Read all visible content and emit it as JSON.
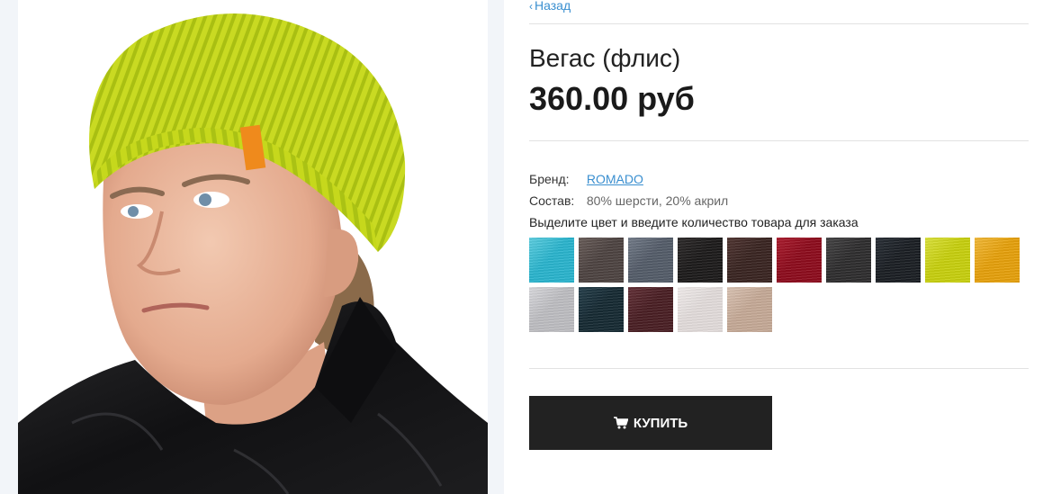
{
  "navigation": {
    "back_label": "Назад"
  },
  "product": {
    "title": "Вегас (флис)",
    "price": "360.00 руб",
    "image_icon": "product-photo-beanie"
  },
  "specs": {
    "brand_label": "Бренд:",
    "brand_value": "ROMADO",
    "composition_label": "Состав:",
    "composition_value": "80% шерсти, 20% акрил"
  },
  "color_prompt": "Выделите цвет и введите количество товара для заказа",
  "swatches": [
    {
      "color": "#2bb6cf",
      "shade": "#5fd0e2"
    },
    {
      "color": "#4e4442",
      "shade": "#6a5e5a"
    },
    {
      "color": "#555d6a",
      "shade": "#747d8a"
    },
    {
      "color": "#1d1b1b",
      "shade": "#2e2b2b"
    },
    {
      "color": "#3a2522",
      "shade": "#513632"
    },
    {
      "color": "#8e0c1d",
      "shade": "#ad1c2e"
    },
    {
      "color": "#2f2e2f",
      "shade": "#464546"
    },
    {
      "color": "#1b1f24",
      "shade": "#2a3038"
    },
    {
      "color": "#c9d10f",
      "shade": "#dde43c"
    },
    {
      "color": "#e8a20c",
      "shade": "#f4bb3a"
    },
    {
      "color": "#bfbfc3",
      "shade": "#dcdce0"
    },
    {
      "color": "#162a33",
      "shade": "#26404c"
    },
    {
      "color": "#4a1f24",
      "shade": "#643138"
    },
    {
      "color": "#e4dedd",
      "shade": "#f4efee"
    },
    {
      "color": "#c7ab98",
      "shade": "#dcc5b5"
    }
  ],
  "buy_button": {
    "label": "КУПИТЬ",
    "icon": "cart-icon"
  }
}
